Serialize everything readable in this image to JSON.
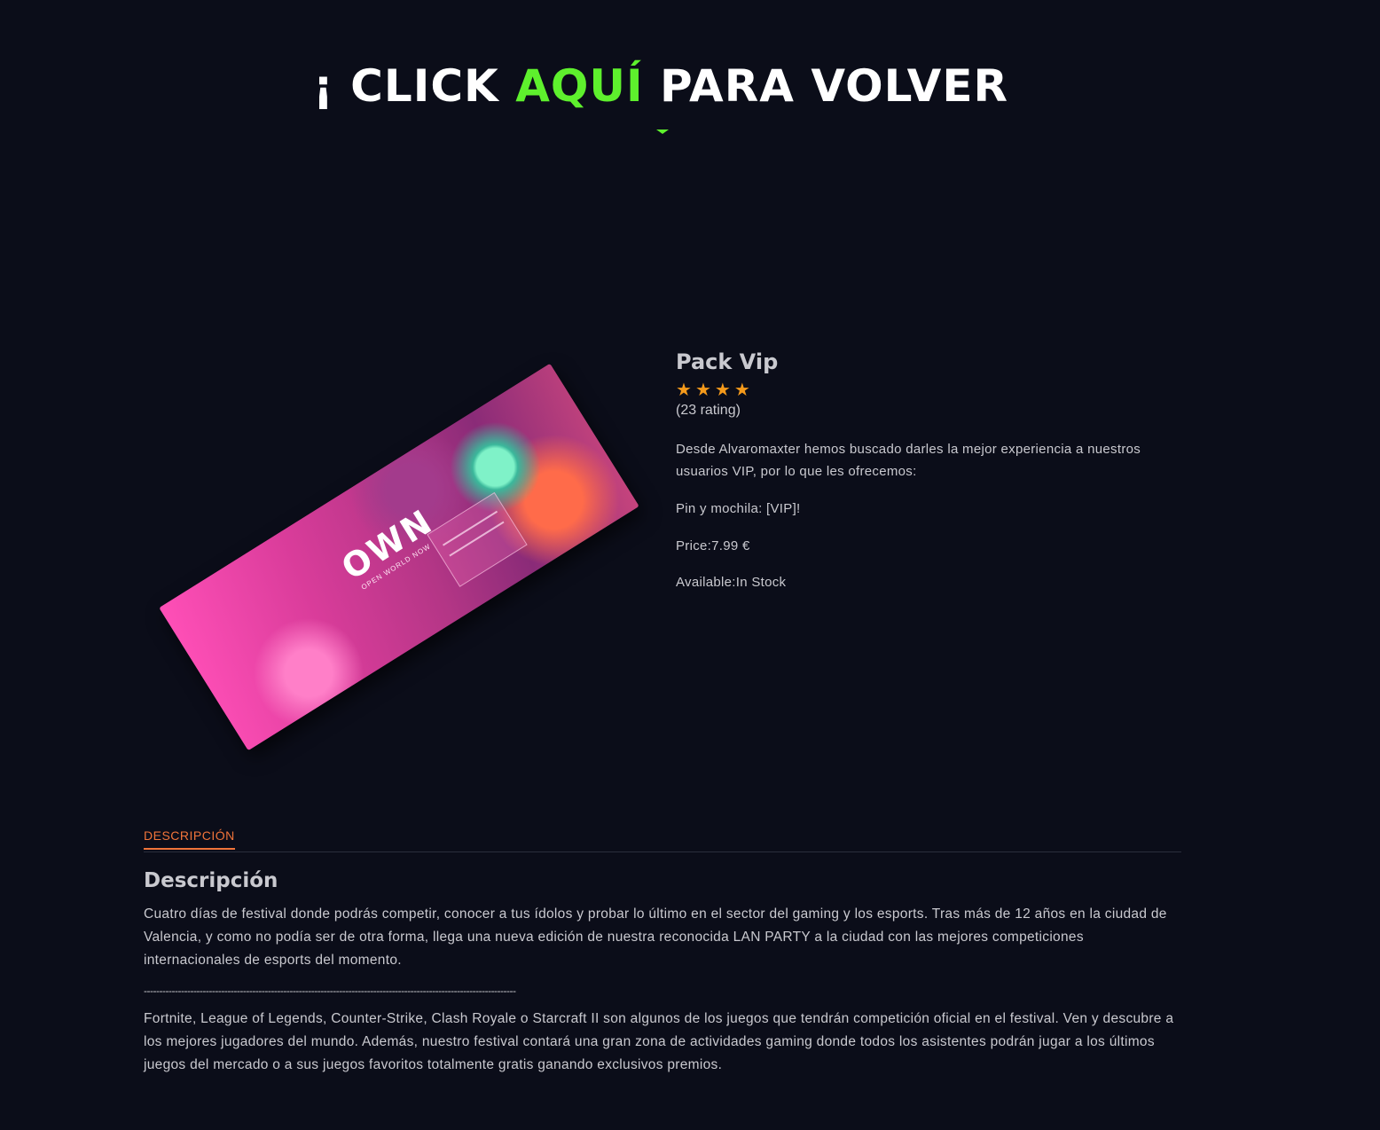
{
  "banner": {
    "prefix": "¡ CLICK ",
    "accent": "AQUÍ",
    "suffix": " PARA VOLVER",
    "accent_color": "#5ef02d"
  },
  "product": {
    "image_logo": "OWN",
    "image_sub": "OPEN WORLD NOW",
    "title": "Pack Vip",
    "rating_stars": 4,
    "rating_count": "(23 rating)",
    "description": "Desde Alvaromaxter hemos buscado darles la mejor experiencia a nuestros usuarios VIP, por lo que les ofrecemos:",
    "pin": "Pin y mochila: [VIP]!",
    "price": "Price:7.99 €",
    "available": "Available:In Stock",
    "star_color": "#f59a1b"
  },
  "tabs": [
    {
      "label": "DESCRIPCIÓN",
      "active": true
    }
  ],
  "description_section": {
    "heading": "Descripción",
    "paragraph1": "Cuatro días de festival donde podrás competir, conocer a tus ídolos y probar lo último en el sector del gaming y los esports. Tras más de 12 años en la ciudad de Valencia, y como no podía ser de otra forma, llega una nueva edición de nuestra reconocida LAN PARTY a la ciudad con las mejores competiciones internacionales de esports del momento.",
    "divider": "------------------------------------------------------------------------------------------------------------------------",
    "paragraph2": "Fortnite, League of Legends, Counter-Strike, Clash Royale o Starcraft II son algunos de los juegos que tendrán competición oficial en el festival. Ven y descubre a los mejores jugadores del mundo. Además, nuestro festival contará una gran zona de actividades gaming donde todos los asistentes podrán jugar a los últimos juegos del mercado o a sus juegos favoritos totalmente gratis ganando exclusivos premios."
  },
  "colors": {
    "background": "#0b0d19",
    "tab_accent": "#f0743a"
  }
}
